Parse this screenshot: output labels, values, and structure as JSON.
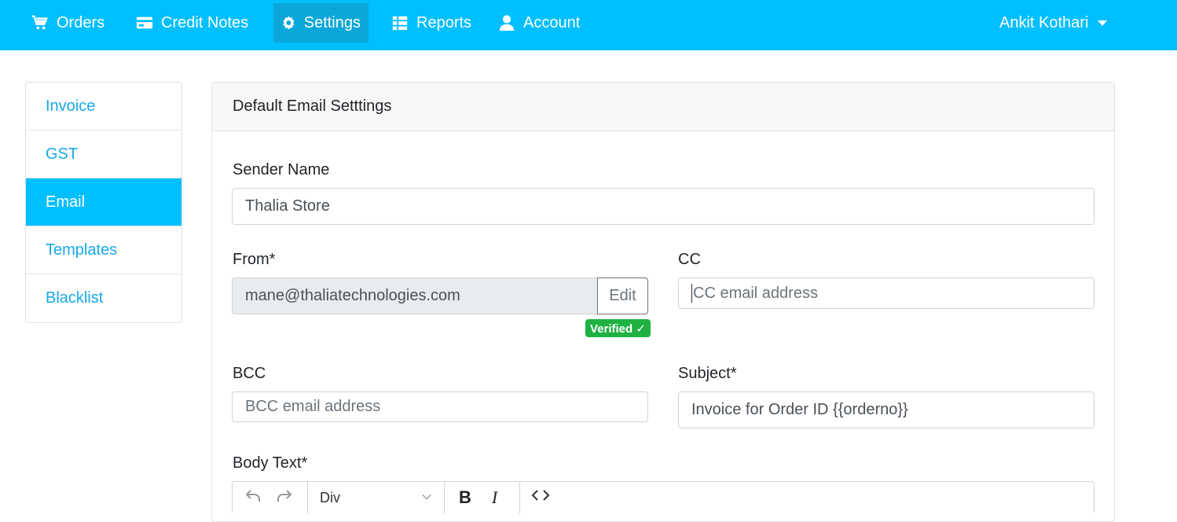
{
  "nav": {
    "orders": "Orders",
    "credit_notes": "Credit Notes",
    "settings": "Settings",
    "reports": "Reports",
    "account": "Account",
    "user": "Ankit Kothari"
  },
  "sidebar": {
    "items": [
      {
        "label": "Invoice"
      },
      {
        "label": "GST"
      },
      {
        "label": "Email"
      },
      {
        "label": "Templates"
      },
      {
        "label": "Blacklist"
      }
    ]
  },
  "card": {
    "title": "Default Email Setttings",
    "sender_name": {
      "label": "Sender Name",
      "value": "Thalia Store"
    },
    "from": {
      "label": "From*",
      "value": "mane@thaliatechnologies.com",
      "edit_label": "Edit",
      "badge": "Verified ✓"
    },
    "cc": {
      "label": "CC",
      "placeholder": "CC email address"
    },
    "bcc": {
      "label": "BCC",
      "placeholder": "BCC email address"
    },
    "subject": {
      "label": "Subject*",
      "value": "Invoice for Order ID {{orderno}}"
    },
    "body": {
      "label": "Body Text*",
      "format_value": "Div",
      "bold": "B",
      "italic": "I"
    }
  },
  "colors": {
    "brand": "#00bfff",
    "link": "#17a9e6",
    "verified": "#1fb141"
  },
  "icons": [
    "cart-icon",
    "credit-card-icon",
    "gear-icon",
    "table-icon",
    "user-icon",
    "caret-down-icon",
    "undo-icon",
    "redo-icon",
    "chevron-down-icon",
    "code-icon"
  ]
}
